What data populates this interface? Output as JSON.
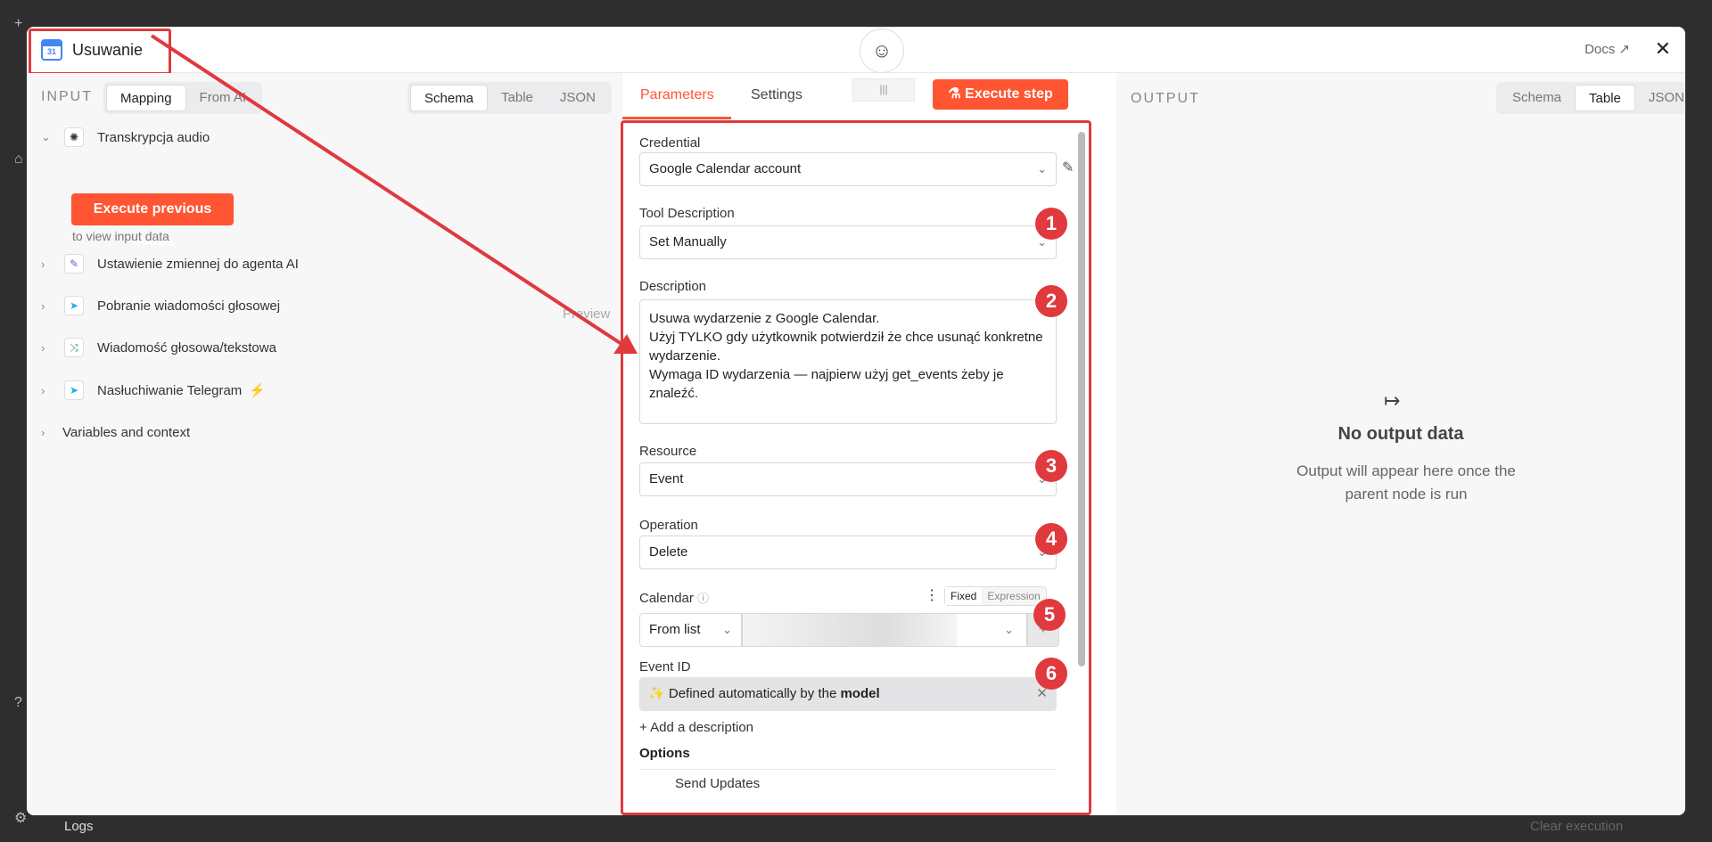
{
  "modal": {
    "title": "Usuwanie",
    "calendar_icon_day": "31",
    "docs_label": "Docs ↗",
    "close_label": "✕"
  },
  "input_panel": {
    "label": "INPUT",
    "mode_tabs": [
      "Mapping",
      "From AI"
    ],
    "view_tabs": [
      "Schema",
      "Table",
      "JSON"
    ],
    "nodes": [
      {
        "label": "Transkrypcja audio",
        "expanded": true
      },
      {
        "label": "Ustawienie zmiennej do agenta AI"
      },
      {
        "label": "Pobranie wiadomości głosowej"
      },
      {
        "label": "Wiadomość głosowa/tekstowa"
      },
      {
        "label": "Nasłuchiwanie Telegram"
      }
    ],
    "variables_label": "Variables and context",
    "execute_previous_label": "Execute previous nodes",
    "to_view_label": "to view input data",
    "preview_label": "Preview"
  },
  "center": {
    "tabs": [
      "Parameters",
      "Settings"
    ],
    "execute_step_label": "Execute step",
    "credential": {
      "label": "Credential",
      "value": "Google Calendar account"
    },
    "tool_description": {
      "label": "Tool Description",
      "value": "Set Manually"
    },
    "description": {
      "label": "Description",
      "value": "Usuwa wydarzenie z Google Calendar.\nUżyj TYLKO gdy użytkownik potwierdził że chce usunąć konkretne wydarzenie.\nWymaga ID wydarzenia — najpierw użyj get_events żeby je znaleźć."
    },
    "resource": {
      "label": "Resource",
      "value": "Event"
    },
    "operation": {
      "label": "Operation",
      "value": "Delete"
    },
    "calendar": {
      "label": "Calendar",
      "mode": "From list",
      "toggle": [
        "Fixed",
        "Expression"
      ]
    },
    "event_id": {
      "label": "Event ID",
      "value_prefix": "Defined automatically by the ",
      "value_bold": "model"
    },
    "add_description_label": "+ Add a description",
    "options_label": "Options",
    "send_updates_label": "Send Updates"
  },
  "badges": [
    "1",
    "2",
    "3",
    "4",
    "5",
    "6"
  ],
  "output_panel": {
    "label": "OUTPUT",
    "view_tabs": [
      "Schema",
      "Table",
      "JSON"
    ],
    "empty_title": "No output data",
    "empty_subtitle": "Output will appear here once the parent node is run"
  },
  "background": {
    "logs_label": "Logs",
    "clear_label": "Clear execution"
  },
  "colors": {
    "accent": "#ff5533",
    "annotation": "#e0393e"
  }
}
